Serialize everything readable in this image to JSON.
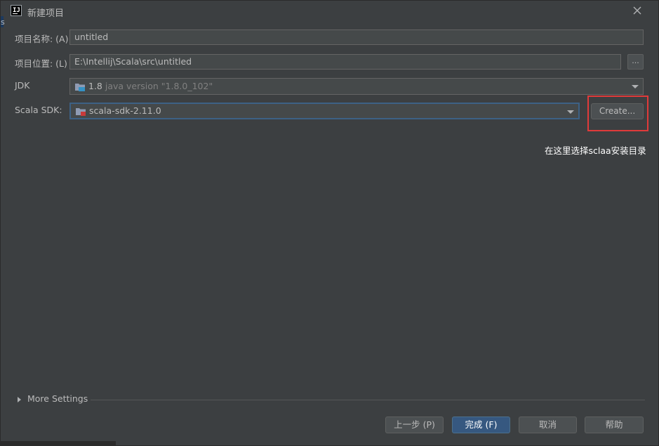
{
  "window": {
    "title": "新建项目",
    "edge_text": "sr"
  },
  "form": {
    "project_name": {
      "label": "项目名称: (A)",
      "value": "untitled"
    },
    "project_location": {
      "label": "项目位置: (L)",
      "value": "E:\\Intellij\\Scala\\src\\untitled",
      "browse_label": "..."
    },
    "jdk": {
      "label": "JDK",
      "version": "1.8",
      "detail": "java version \"1.8.0_102\""
    },
    "scala_sdk": {
      "label": "Scala SDK:",
      "value": "scala-sdk-2.11.0",
      "create_label": "Create..."
    }
  },
  "annotation": {
    "text": "在这里选择sclaa安装目录",
    "color": "#e03a3a"
  },
  "more_settings": {
    "label": "More Settings"
  },
  "footer": {
    "previous": "上一步 (P)",
    "finish": "完成 (F)",
    "cancel": "取消",
    "help": "帮助"
  },
  "colors": {
    "background": "#3c3f41",
    "field": "#45494a",
    "primary_button": "#365880",
    "focus_border": "#3d6185"
  }
}
